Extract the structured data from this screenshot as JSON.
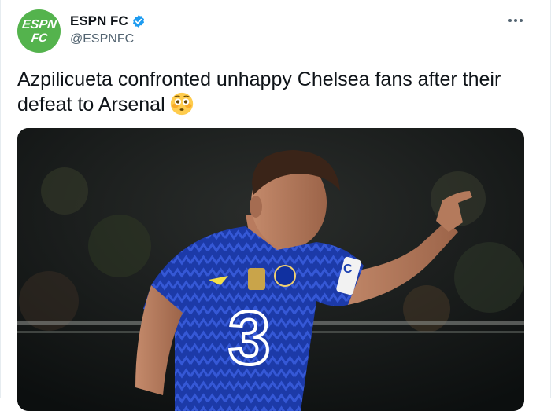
{
  "author": {
    "display_name": "ESPN FC",
    "handle": "@ESPNFC",
    "avatar_text_top": "ESPN",
    "avatar_text_bottom": "FC",
    "avatar_color": "#54b34d",
    "verified": true,
    "verified_icon": "verified-badge-icon"
  },
  "tweet": {
    "text": "Azpilicueta confronted unhappy Chelsea fans after their defeat to Arsenal",
    "emoji": "flushed-face-emoji"
  },
  "media": {
    "kit_sponsor": "3",
    "captain_armband": "C"
  },
  "colors": {
    "text_primary": "#0f1419",
    "text_secondary": "#536471",
    "verified_blue": "#1d9bf0",
    "kit_blue": "#1a3fb0"
  }
}
